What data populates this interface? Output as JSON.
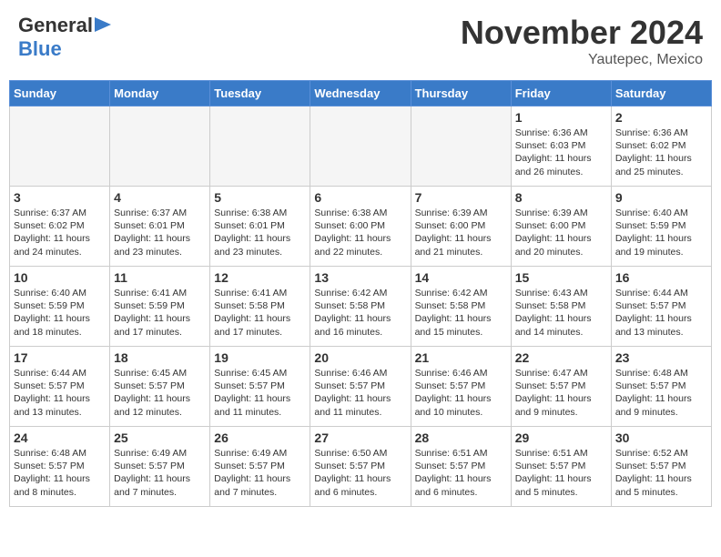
{
  "header": {
    "logo_general": "General",
    "logo_blue": "Blue",
    "month_title": "November 2024",
    "subtitle": "Yautepec, Mexico"
  },
  "days_of_week": [
    "Sunday",
    "Monday",
    "Tuesday",
    "Wednesday",
    "Thursday",
    "Friday",
    "Saturday"
  ],
  "weeks": [
    [
      {
        "day": "",
        "info": ""
      },
      {
        "day": "",
        "info": ""
      },
      {
        "day": "",
        "info": ""
      },
      {
        "day": "",
        "info": ""
      },
      {
        "day": "",
        "info": ""
      },
      {
        "day": "1",
        "info": "Sunrise: 6:36 AM\nSunset: 6:03 PM\nDaylight: 11 hours and 26 minutes."
      },
      {
        "day": "2",
        "info": "Sunrise: 6:36 AM\nSunset: 6:02 PM\nDaylight: 11 hours and 25 minutes."
      }
    ],
    [
      {
        "day": "3",
        "info": "Sunrise: 6:37 AM\nSunset: 6:02 PM\nDaylight: 11 hours and 24 minutes."
      },
      {
        "day": "4",
        "info": "Sunrise: 6:37 AM\nSunset: 6:01 PM\nDaylight: 11 hours and 23 minutes."
      },
      {
        "day": "5",
        "info": "Sunrise: 6:38 AM\nSunset: 6:01 PM\nDaylight: 11 hours and 23 minutes."
      },
      {
        "day": "6",
        "info": "Sunrise: 6:38 AM\nSunset: 6:00 PM\nDaylight: 11 hours and 22 minutes."
      },
      {
        "day": "7",
        "info": "Sunrise: 6:39 AM\nSunset: 6:00 PM\nDaylight: 11 hours and 21 minutes."
      },
      {
        "day": "8",
        "info": "Sunrise: 6:39 AM\nSunset: 6:00 PM\nDaylight: 11 hours and 20 minutes."
      },
      {
        "day": "9",
        "info": "Sunrise: 6:40 AM\nSunset: 5:59 PM\nDaylight: 11 hours and 19 minutes."
      }
    ],
    [
      {
        "day": "10",
        "info": "Sunrise: 6:40 AM\nSunset: 5:59 PM\nDaylight: 11 hours and 18 minutes."
      },
      {
        "day": "11",
        "info": "Sunrise: 6:41 AM\nSunset: 5:59 PM\nDaylight: 11 hours and 17 minutes."
      },
      {
        "day": "12",
        "info": "Sunrise: 6:41 AM\nSunset: 5:58 PM\nDaylight: 11 hours and 17 minutes."
      },
      {
        "day": "13",
        "info": "Sunrise: 6:42 AM\nSunset: 5:58 PM\nDaylight: 11 hours and 16 minutes."
      },
      {
        "day": "14",
        "info": "Sunrise: 6:42 AM\nSunset: 5:58 PM\nDaylight: 11 hours and 15 minutes."
      },
      {
        "day": "15",
        "info": "Sunrise: 6:43 AM\nSunset: 5:58 PM\nDaylight: 11 hours and 14 minutes."
      },
      {
        "day": "16",
        "info": "Sunrise: 6:44 AM\nSunset: 5:57 PM\nDaylight: 11 hours and 13 minutes."
      }
    ],
    [
      {
        "day": "17",
        "info": "Sunrise: 6:44 AM\nSunset: 5:57 PM\nDaylight: 11 hours and 13 minutes."
      },
      {
        "day": "18",
        "info": "Sunrise: 6:45 AM\nSunset: 5:57 PM\nDaylight: 11 hours and 12 minutes."
      },
      {
        "day": "19",
        "info": "Sunrise: 6:45 AM\nSunset: 5:57 PM\nDaylight: 11 hours and 11 minutes."
      },
      {
        "day": "20",
        "info": "Sunrise: 6:46 AM\nSunset: 5:57 PM\nDaylight: 11 hours and 11 minutes."
      },
      {
        "day": "21",
        "info": "Sunrise: 6:46 AM\nSunset: 5:57 PM\nDaylight: 11 hours and 10 minutes."
      },
      {
        "day": "22",
        "info": "Sunrise: 6:47 AM\nSunset: 5:57 PM\nDaylight: 11 hours and 9 minutes."
      },
      {
        "day": "23",
        "info": "Sunrise: 6:48 AM\nSunset: 5:57 PM\nDaylight: 11 hours and 9 minutes."
      }
    ],
    [
      {
        "day": "24",
        "info": "Sunrise: 6:48 AM\nSunset: 5:57 PM\nDaylight: 11 hours and 8 minutes."
      },
      {
        "day": "25",
        "info": "Sunrise: 6:49 AM\nSunset: 5:57 PM\nDaylight: 11 hours and 7 minutes."
      },
      {
        "day": "26",
        "info": "Sunrise: 6:49 AM\nSunset: 5:57 PM\nDaylight: 11 hours and 7 minutes."
      },
      {
        "day": "27",
        "info": "Sunrise: 6:50 AM\nSunset: 5:57 PM\nDaylight: 11 hours and 6 minutes."
      },
      {
        "day": "28",
        "info": "Sunrise: 6:51 AM\nSunset: 5:57 PM\nDaylight: 11 hours and 6 minutes."
      },
      {
        "day": "29",
        "info": "Sunrise: 6:51 AM\nSunset: 5:57 PM\nDaylight: 11 hours and 5 minutes."
      },
      {
        "day": "30",
        "info": "Sunrise: 6:52 AM\nSunset: 5:57 PM\nDaylight: 11 hours and 5 minutes."
      }
    ]
  ]
}
